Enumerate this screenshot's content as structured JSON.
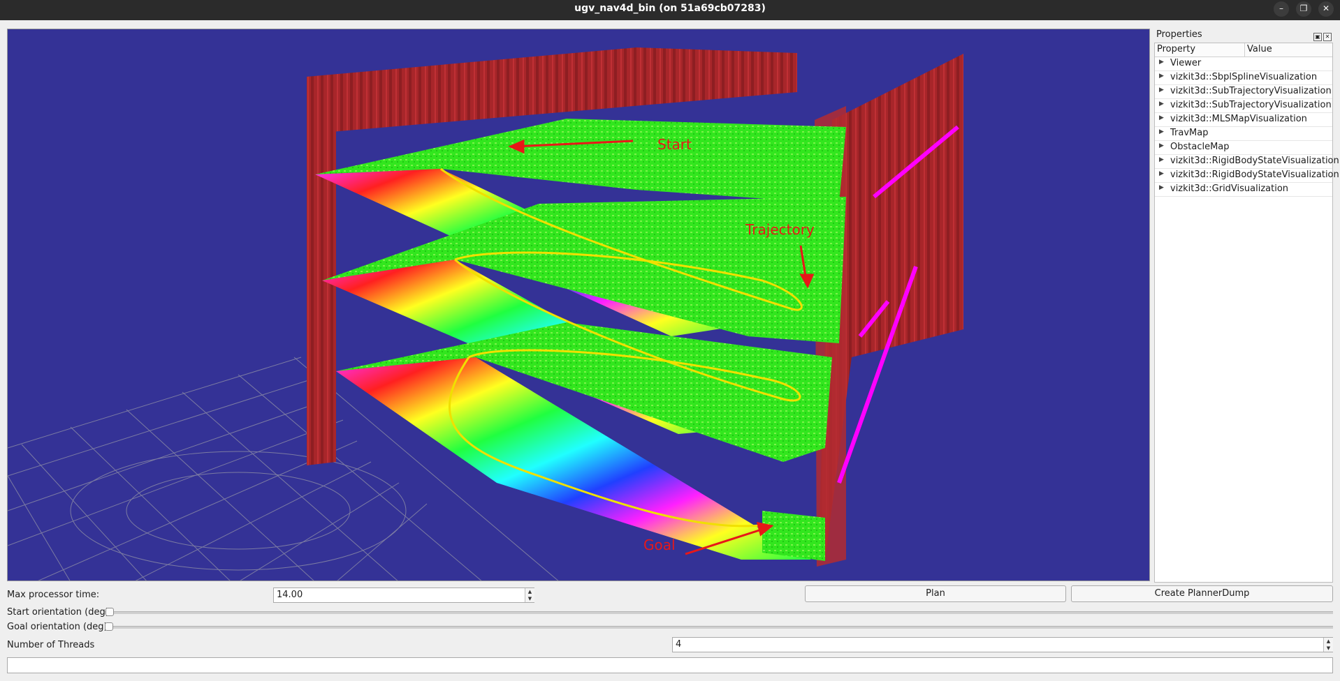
{
  "window": {
    "title": "ugv_nav4d_bin (on 51a69cb07283)",
    "minimize_icon": "minimize-icon",
    "restore_icon": "restore-icon",
    "close_icon": "close-icon"
  },
  "viewer": {
    "annotations": {
      "start": "Start",
      "trajectory": "Trajectory",
      "goal": "Goal"
    },
    "colors": {
      "background": "#343296",
      "walls": "#a8262a",
      "surface": "#32e61e",
      "trajectory": "#f0e000",
      "annotation": "#e81818",
      "obstacle_edges": "#ff00ff"
    }
  },
  "properties": {
    "title": "Properties",
    "columns": [
      "Property",
      "Value"
    ],
    "items": [
      {
        "label": "Viewer"
      },
      {
        "label": "vizkit3d::SbplSplineVisualization"
      },
      {
        "label": "vizkit3d::SubTrajectoryVisualization"
      },
      {
        "label": "vizkit3d::SubTrajectoryVisualization"
      },
      {
        "label": "vizkit3d::MLSMapVisualization"
      },
      {
        "label": "TravMap"
      },
      {
        "label": "ObstacleMap"
      },
      {
        "label": "vizkit3d::RigidBodyStateVisualization"
      },
      {
        "label": "vizkit3d::RigidBodyStateVisualization"
      },
      {
        "label": "vizkit3d::GridVisualization"
      }
    ]
  },
  "controls": {
    "max_processor_time": {
      "label": "Max processor time:",
      "value": "14.00"
    },
    "plan_button": "Plan",
    "create_dump_button": "Create PlannerDump",
    "start_orientation": {
      "label": "Start orientation (deg)",
      "value": 0
    },
    "goal_orientation": {
      "label": "Goal orientation (deg)",
      "value": 0
    },
    "threads": {
      "label": "Number of Threads",
      "value": "4"
    },
    "bottom_input": {
      "value": ""
    }
  }
}
